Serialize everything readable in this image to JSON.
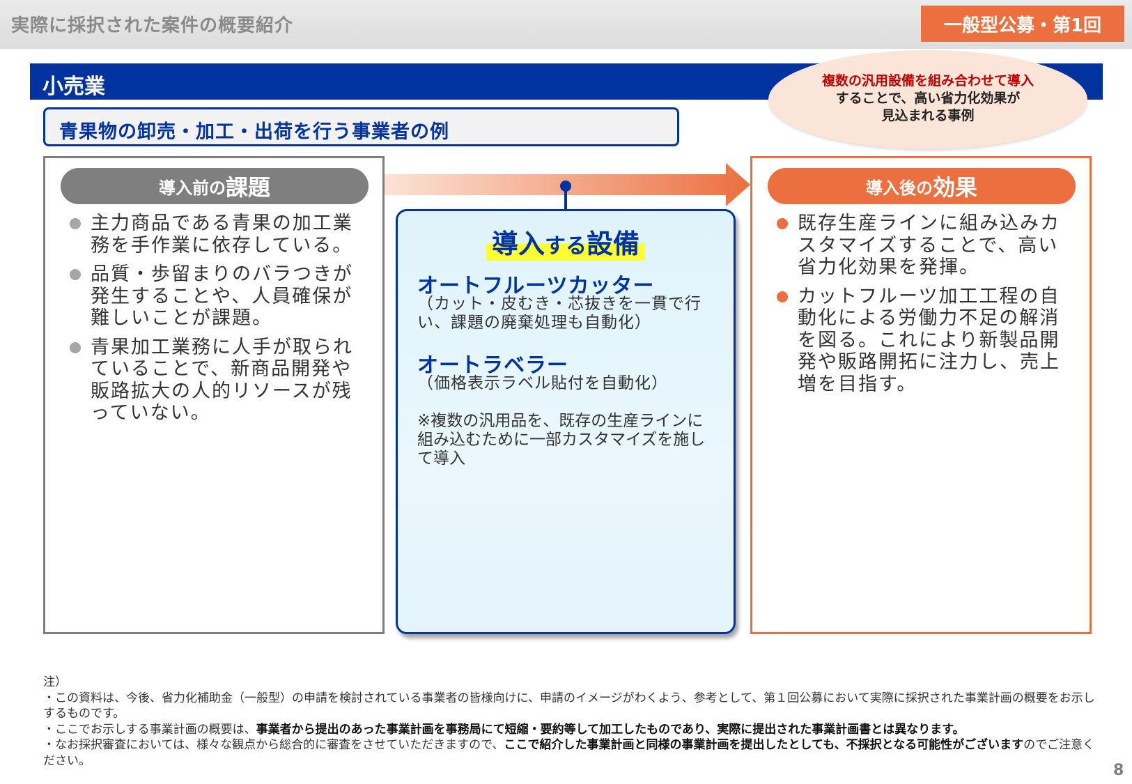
{
  "header": {
    "title": "実際に採択された案件の概要紹介",
    "round_badge": "一般型公募・第1回"
  },
  "industry": {
    "label": "小売業"
  },
  "highlight": {
    "line1": "複数の汎用設備を組み合わせて導入",
    "line2": "することで、高い省力化効果が",
    "line3": "見込まれる事例"
  },
  "case_title": "青果物の卸売・加工・出荷を行う事業者の例",
  "before": {
    "header_small": "導入前の",
    "header_big": "課題",
    "bullets": [
      "主力商品である青果の加工業務を手作業に依存している。",
      "品質・歩留まりのバラつきが発生することや、人員確保が難しいことが課題。",
      "青果加工業務に人手が取られていることで、新商品開発や販路拡大の人的リソースが残っていない。"
    ]
  },
  "equipment": {
    "title_part1": "導入",
    "title_part2": "する",
    "title_part3": "設備",
    "items": [
      {
        "name": "オートフルーツカッター",
        "desc": "（カット・皮むき・芯抜きを一貫で行い、課題の廃棄処理も自動化）"
      },
      {
        "name": "オートラベラー",
        "desc": "（価格表示ラベル貼付を自動化）"
      }
    ],
    "note": "※複数の汎用品を、既存の生産ラインに組み込むために一部カスタマイズを施して導入"
  },
  "after": {
    "header_small": "導入後の",
    "header_big": "効果",
    "bullets": [
      "既存生産ラインに組み込みカスタマイズすることで、高い省力化効果を発揮。",
      "カットフルーツ加工工程の自動化による労働力不足の解消を図る。これにより新製品開発や販路開拓に注力し、売上増を目指す。"
    ]
  },
  "footnotes": {
    "heading": "注）",
    "line1": "・この資料は、今後、省力化補助金（一般型）の申請を検討されている事業者の皆様向けに、申請のイメージがわくよう、参考として、第１回公募において実際に採択された事業計画の概要をお示しするものです。",
    "line2_plain": "・ここでお示しする事業計画の概要は、",
    "line2_bold": "事業者から提出のあった事業計画を事務局にて短縮・要約等して加工したものであり、実際に提出された事業計画書とは異なります。",
    "line3_plain": "・なお採択審査においては、様々な観点から総合的に審査をさせていただきますので、",
    "line3_bold": "ここで紹介した事業計画と同様の事業計画を提出したとしても、不採択となる可能性がございます",
    "line3_end": "のでご注意ください。"
  },
  "page_number": "8",
  "colors": {
    "accent_orange": "#ec6f3f",
    "brand_blue": "#0033a0",
    "grey": "#7f7f7f",
    "highlight_yellow": "#ffff33"
  }
}
